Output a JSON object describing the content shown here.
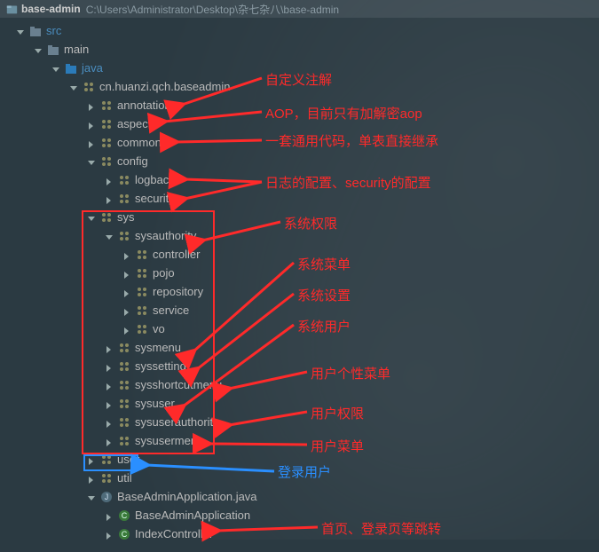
{
  "title": {
    "project": "base-admin",
    "path": "C:\\Users\\Administrator\\Desktop\\杂七杂八\\base-admin"
  },
  "tree": {
    "src": "src",
    "main": "main",
    "java": "java",
    "pkg": "cn.huanzi.qch.baseadmin",
    "annotation": "annotation",
    "aspect": "aspect",
    "common": "common",
    "config": "config",
    "logback": "logback",
    "security": "security",
    "sys": "sys",
    "sysauthority": "sysauthority",
    "controller": "controller",
    "pojo": "pojo",
    "repository": "repository",
    "service": "service",
    "vo": "vo",
    "sysmenu": "sysmenu",
    "syssetting": "syssetting",
    "sysshortcutmenu": "sysshortcutmenu",
    "sysuser": "sysuser",
    "sysuserauthority": "sysuserauthority",
    "sysusermenu": "sysusermenu",
    "user": "user",
    "util": "util",
    "appjava": "BaseAdminApplication.java",
    "appclass": "BaseAdminApplication",
    "indexctrl": "IndexController"
  },
  "anno": {
    "annotation": "自定义注解",
    "aspect": "AOP，目前只有加解密aop",
    "common": "一套通用代码，单表直接继承",
    "config": "日志的配置、security的配置",
    "sys": "系统权限",
    "sysmenu": "系统菜单",
    "syssetting": "系统设置",
    "sysuser": "系统用户",
    "sysshortcut": "用户个性菜单",
    "sysuserauth": "用户权限",
    "sysusermenu": "用户菜单",
    "user": "登录用户",
    "indexctrl": "首页、登录页等跳转"
  }
}
